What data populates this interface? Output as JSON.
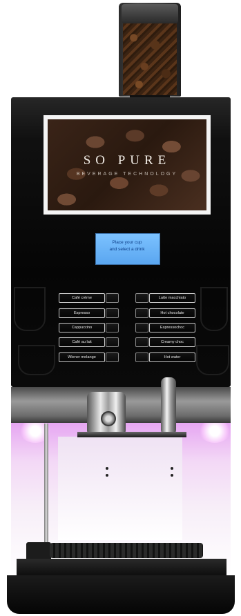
{
  "screen": {
    "brand": "SO PURE",
    "tagline": "BEVERAGE TECHNOLOGY"
  },
  "lcd": {
    "line1": "Place your cup",
    "line2": "and select a drink"
  },
  "drinks_left": [
    "Café crème",
    "Espresso",
    "Cappuccino",
    "Café au lait",
    "Wiener melange"
  ],
  "drinks_right": [
    "Latte macchiato",
    "Hot chocolate",
    "Espressochoc",
    "Creamy choc",
    "Hot water"
  ],
  "colors": {
    "lcd": "#6bb4ff",
    "cavity_light": "#e6a6f2",
    "body": "#0a0a0a"
  }
}
